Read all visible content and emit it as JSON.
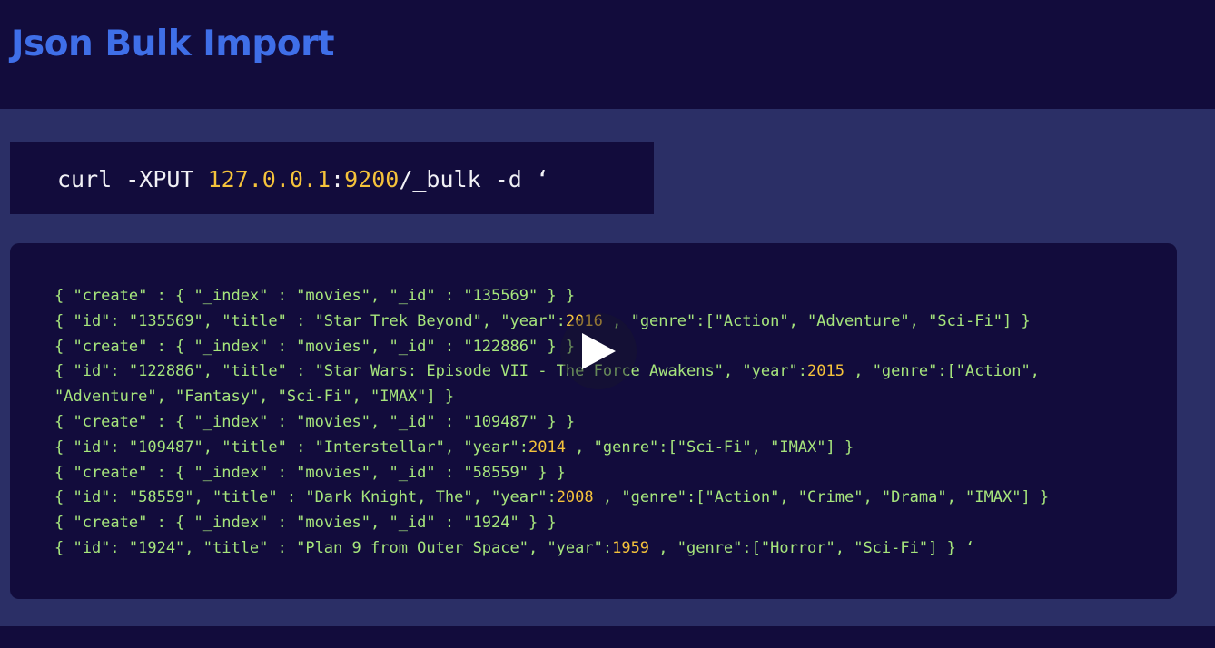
{
  "header": {
    "title": "Json Bulk Import"
  },
  "command": {
    "prefix": "curl -XPUT ",
    "host": "127.0.0.1",
    "colon": ":",
    "port": "9200",
    "suffix": "/_bulk -d ‘"
  },
  "code_lines": [
    {
      "before": "{ \"create\" : { \"_index\" : \"movies\", \"_id\" : \"135569\" } }",
      "year": "",
      "after": ""
    },
    {
      "before": "{ \"id\": \"135569\", \"title\" : \"Star Trek Beyond\", \"year\":",
      "year": "2016",
      "after": " , \"genre\":[\"Action\", \"Adventure\", \"Sci-Fi\"] }"
    },
    {
      "before": "{ \"create\" : { \"_index\" : \"movies\", \"_id\" : \"122886\" } }",
      "year": "",
      "after": ""
    },
    {
      "before": "{ \"id\": \"122886\", \"title\" : \"Star Wars: Episode VII - The Force Awakens\", \"year\":",
      "year": "2015",
      "after": " , \"genre\":[\"Action\", \"Adventure\", \"Fantasy\", \"Sci-Fi\", \"IMAX\"] }"
    },
    {
      "before": "{ \"create\" : { \"_index\" : \"movies\", \"_id\" : \"109487\" } }",
      "year": "",
      "after": ""
    },
    {
      "before": "{ \"id\": \"109487\", \"title\" : \"Interstellar\", \"year\":",
      "year": "2014",
      "after": " , \"genre\":[\"Sci-Fi\", \"IMAX\"] }"
    },
    {
      "before": "{ \"create\" : { \"_index\" : \"movies\", \"_id\" : \"58559\" } }",
      "year": "",
      "after": ""
    },
    {
      "before": "{ \"id\": \"58559\", \"title\" : \"Dark Knight, The\", \"year\":",
      "year": "2008",
      "after": " , \"genre\":[\"Action\", \"Crime\", \"Drama\", \"IMAX\"] }"
    },
    {
      "before": "{ \"create\" : { \"_index\" : \"movies\", \"_id\" : \"1924\" } }",
      "year": "",
      "after": ""
    },
    {
      "before": "{ \"id\": \"1924\", \"title\" : \"Plan 9 from Outer Space\", \"year\":",
      "year": "1959",
      "after": " , \"genre\":[\"Horror\", \"Sci-Fi\"] } ‘"
    }
  ],
  "play_button": {
    "icon": "play-icon"
  },
  "colors": {
    "header_bg": "#120c3c",
    "page_bg": "#2b2f66",
    "title": "#3f6fe8",
    "code_text": "#a6e57c",
    "highlight": "#f5c33b"
  }
}
